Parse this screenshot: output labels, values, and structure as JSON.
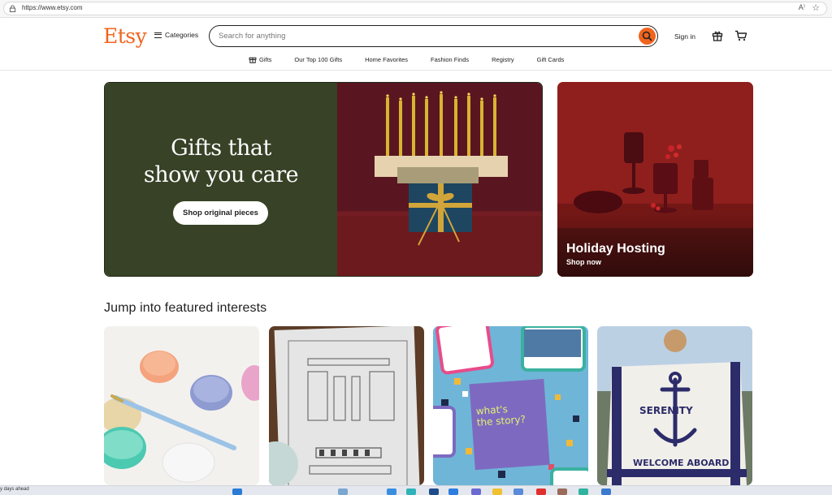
{
  "browser": {
    "url": "https://www.etsy.com",
    "read_aloud": "A⁾",
    "favorite_icon": "star-icon"
  },
  "header": {
    "logo": "Etsy",
    "categories_label": "Categories",
    "search_placeholder": "Search for anything",
    "signin_label": "Sign in",
    "accent": "#f1641e"
  },
  "nav": {
    "items": [
      "Gifts",
      "Our Top 100 Gifts",
      "Home Favorites",
      "Fashion Finds",
      "Registry",
      "Gift Cards"
    ]
  },
  "hero": {
    "title_line1": "Gifts that",
    "title_line2": "show you care",
    "button": "Shop original pieces",
    "bg_color": "#374226"
  },
  "holiday": {
    "title": "Holiday Hosting",
    "subtitle": "Shop now"
  },
  "featured": {
    "title": "Jump into featured interests"
  },
  "statusbar": {
    "text": "y days ahead"
  }
}
